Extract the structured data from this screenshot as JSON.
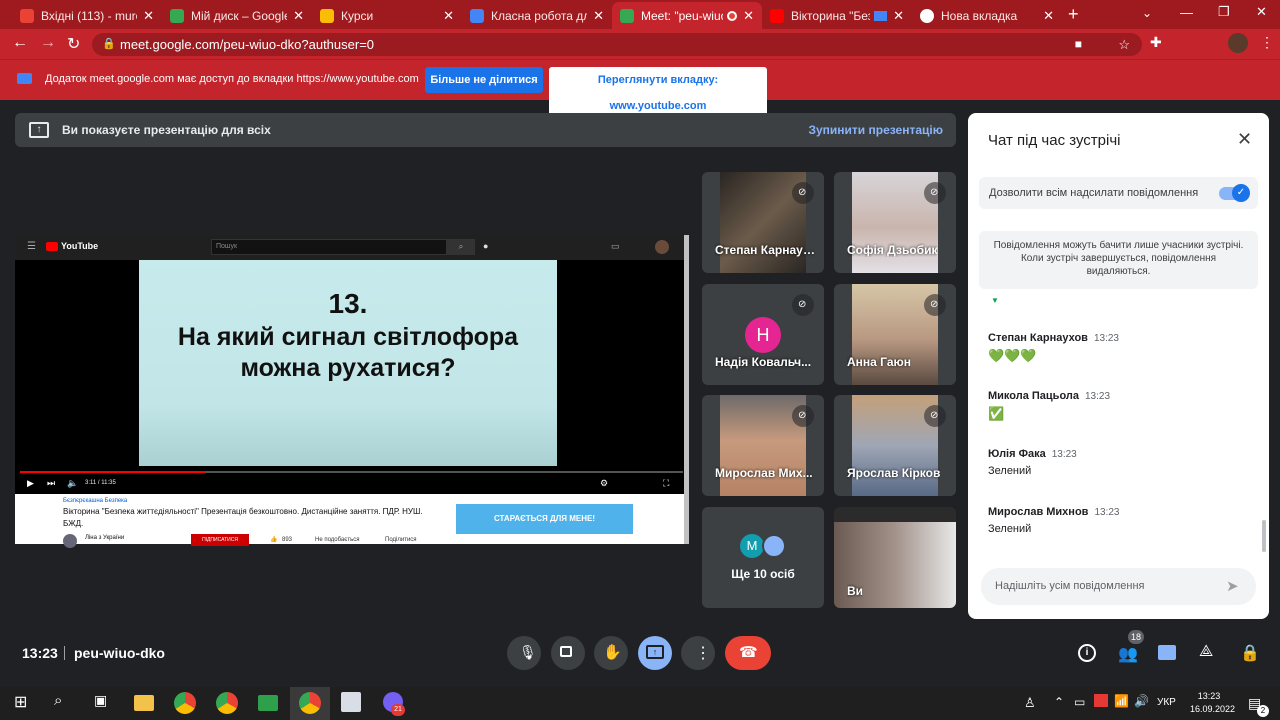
{
  "browser": {
    "tabs": [
      {
        "label": "Вхідні (113) - murosla",
        "color": "#ea4335",
        "active": false
      },
      {
        "label": "Мій диск – Google Ди",
        "color": "#34a853",
        "active": false
      },
      {
        "label": "Курси",
        "color": "#fbbc04",
        "active": false
      },
      {
        "label": "Класна робота для к",
        "color": "#4285f4",
        "active": false
      },
      {
        "label": "Meet: \"peu-wiuo-",
        "color": "#34a853",
        "active": true
      },
      {
        "label": "Вікторина \"Безпе",
        "color": "#ff0000",
        "active": false
      },
      {
        "label": "Нова вкладка",
        "color": "#ffffff",
        "active": false
      }
    ],
    "url": "meet.google.com/peu-wiuo-dko?authuser=0",
    "infobar": {
      "text": "Додаток meet.google.com має доступ до вкладки https://www.youtube.com",
      "stop_label": "Більше не ділитися",
      "view_label": "Переглянути вкладку: www.youtube.com"
    }
  },
  "meet": {
    "present_text": "Ви показуєте презентацію для всіх",
    "stop_present": "Зупинити презентацію",
    "youtube": {
      "logo": "YouTube",
      "search": "Пошук",
      "slide_number": "13.",
      "slide_line1": "На який сигнал світлофора",
      "slide_line2": "можна рухатися?",
      "time": "3:11 / 11:35",
      "tag": "Бєзпєрєкашна Безпека",
      "video_title": "Вікторина \"Безпека життєдіяльності\" Презентація безкоштовно. Дистанційне заняття. ПДР. НУШ. БЖД.",
      "channel": "Ліна з України",
      "subscribe": "ПІДПИСАТИСЯ",
      "likes": "893",
      "dislike": "Не подобається",
      "share": "Поділитися",
      "ad": "СТАРАЄТЬСЯ ДЛЯ МЕНЕ!"
    },
    "participants": [
      {
        "name": "Степан Карнаух..."
      },
      {
        "name": "Софія Дзьобик"
      },
      {
        "name": "Надія Ковальч...",
        "initial": "Н"
      },
      {
        "name": "Анна Гаюн"
      },
      {
        "name": "Мирослав Мих..."
      },
      {
        "name": "Ярослав Кірков"
      }
    ],
    "more": {
      "label": "Ще 10 осіб",
      "initial": "М"
    },
    "self_label": "Ви",
    "time": "13:23",
    "code": "peu-wiuo-dko",
    "people_count": "18"
  },
  "chat": {
    "title": "Чат під час зустрічі",
    "allow_label": "Дозволити всім надсилати повідомлення",
    "notice": "Повідомлення можуть бачити лише учасники зустрічі. Коли зустріч завершується, повідомлення видаляються.",
    "messages": [
      {
        "name": "Степан Карнаухов",
        "time": "13:23",
        "text": "💚💚💚"
      },
      {
        "name": "Микола Пацьола",
        "time": "13:23",
        "text": "✅"
      },
      {
        "name": "Юлія Фака",
        "time": "13:23",
        "text": "Зелений"
      },
      {
        "name": "Мирослав Михнов",
        "time": "13:23",
        "text": "Зелений"
      }
    ],
    "input_placeholder": "Надішліть усім повідомлення"
  },
  "taskbar": {
    "lang": "УКР",
    "time": "13:23",
    "date": "16.09.2022",
    "notif": "2",
    "viber_badge": "21"
  }
}
